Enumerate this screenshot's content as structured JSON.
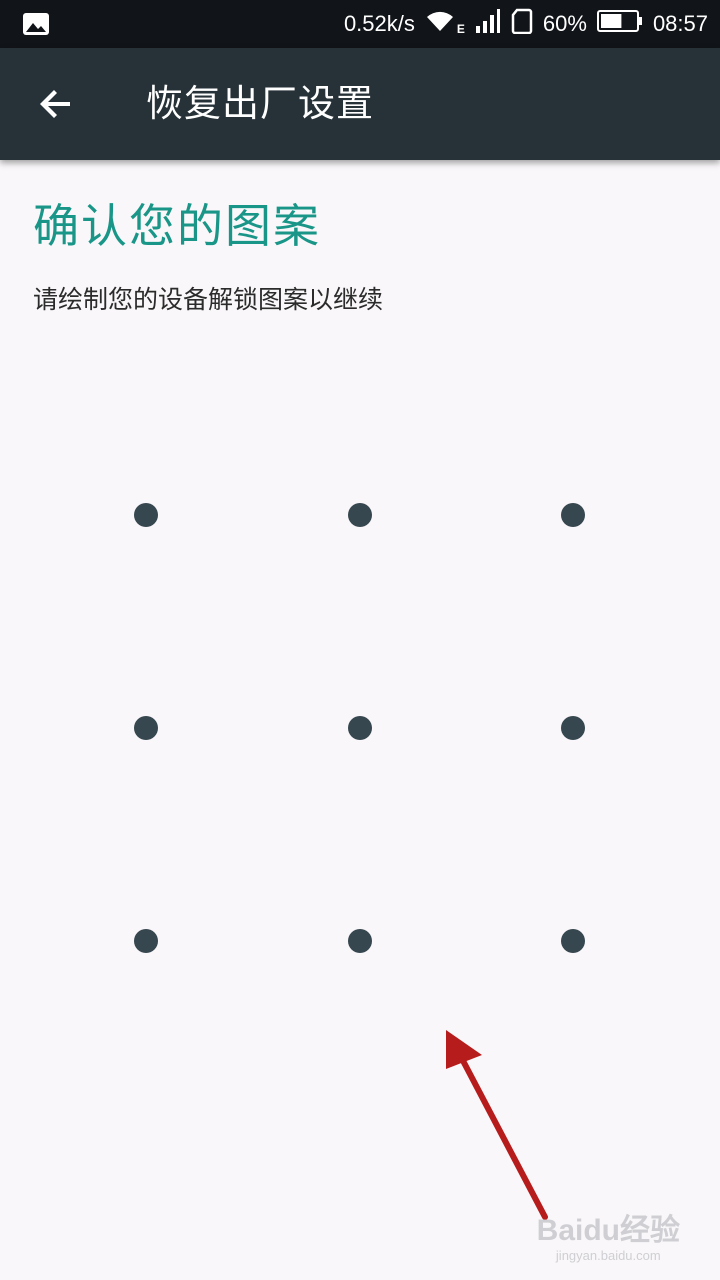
{
  "status_bar": {
    "net_speed": "0.52k/s",
    "network_type": "E",
    "battery_percent": "60%",
    "battery_level": 0.6,
    "time": "08:57",
    "icons": [
      "image-icon",
      "wifi-icon",
      "signal-icon",
      "sim-icon",
      "battery-icon"
    ]
  },
  "toolbar": {
    "title": "恢复出厂设置",
    "back_icon": "back-arrow-icon",
    "background": "#263238"
  },
  "content": {
    "heading": "确认您的图案",
    "heading_color": "#1a9688",
    "subtext": "请绘制您的设备解锁图案以继续"
  },
  "pattern": {
    "rows": 3,
    "cols": 3,
    "dot_color": "#37474f"
  },
  "annotation": {
    "arrow_color": "#b71c1c",
    "arrow_icon": "red-arrow-icon"
  },
  "watermark": {
    "main": "Baidu经验",
    "sub": "jingyan.baidu.com"
  }
}
